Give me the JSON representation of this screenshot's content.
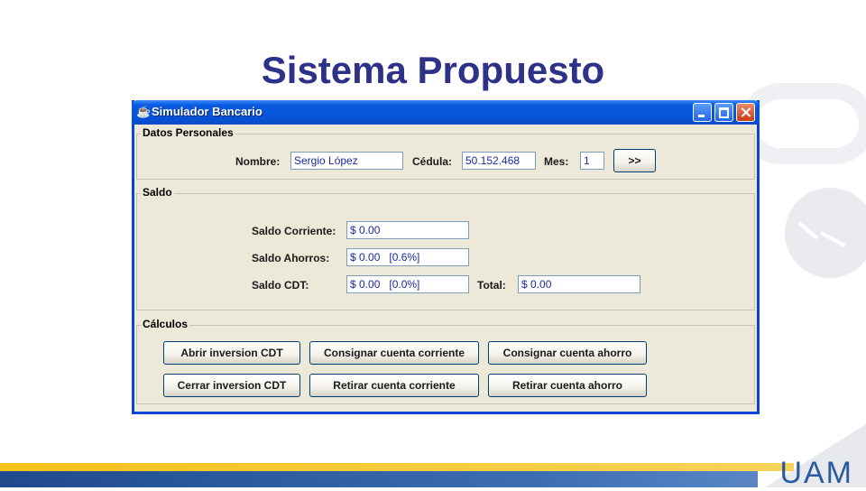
{
  "slide": {
    "title": "Sistema Propuesto",
    "logo": "UAM"
  },
  "window": {
    "title": "Simulador Bancario",
    "icon": "java-cup-icon"
  },
  "personal": {
    "legend": "Datos Personales",
    "name_label": "Nombre:",
    "name_value": "Sergio López",
    "id_label": "Cédula:",
    "id_value": "50.152.468",
    "month_label": "Mes:",
    "month_value": "1",
    "next_label": ">>"
  },
  "balance": {
    "legend": "Saldo",
    "current_label": "Saldo Corriente:",
    "current_value": "$ 0.00",
    "savings_label": "Saldo Ahorros:",
    "savings_value": "$ 0.00   [0.6%]",
    "cdt_label": "Saldo CDT:",
    "cdt_value": "$ 0.00   [0.0%]",
    "total_label": "Total:",
    "total_value": "$ 0.00"
  },
  "calculations": {
    "legend": "Cálculos",
    "open_cdt": "Abrir inversion CDT",
    "deposit_current": "Consignar cuenta corriente",
    "deposit_savings": "Consignar cuenta ahorro",
    "close_cdt": "Cerrar inversion CDT",
    "withdraw_current": "Retirar cuenta corriente",
    "withdraw_savings": "Retirar cuenta ahorro"
  }
}
